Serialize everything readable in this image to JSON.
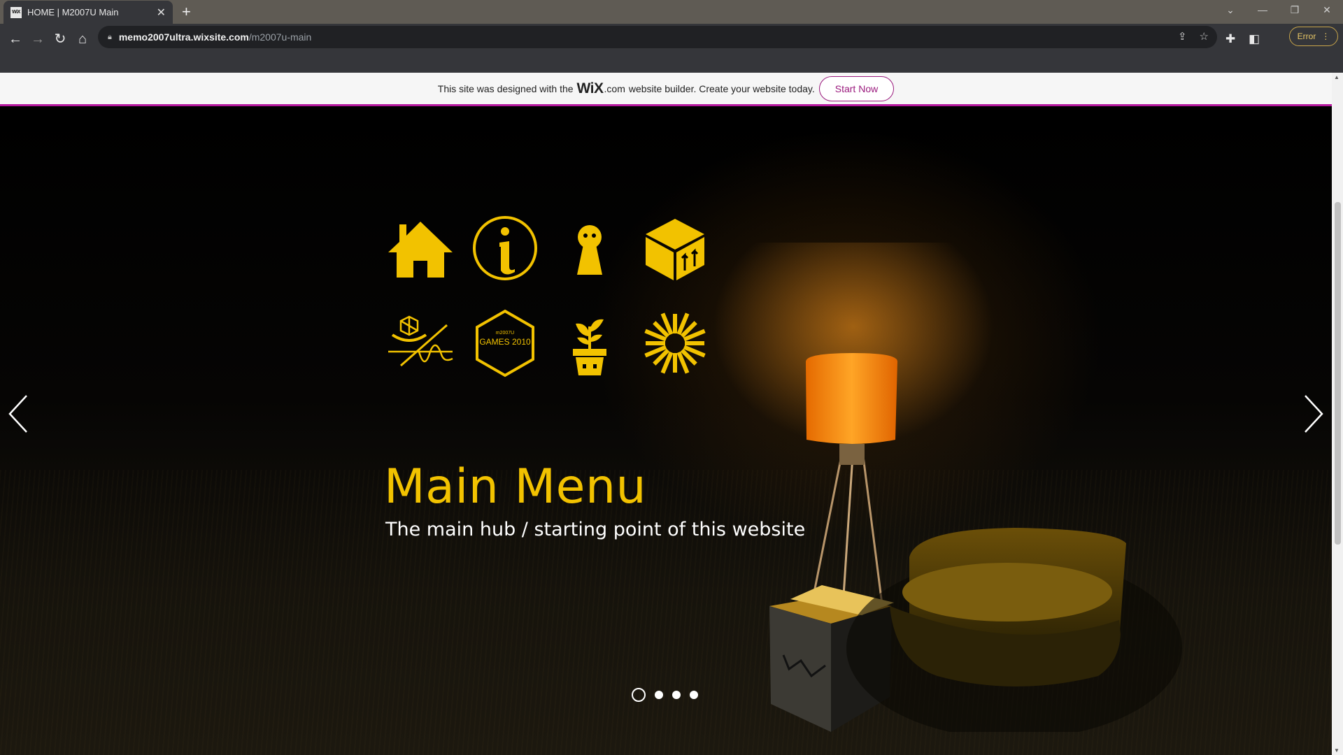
{
  "browser": {
    "tab_title": "HOME | M2007U Main",
    "tab_favicon": "WiX",
    "url_host": "memo2007ultra.wixsite.com",
    "url_path": "/m2007u-main",
    "error_label": "Error"
  },
  "wix_banner": {
    "text_before": "This site was designed with the",
    "logo": "WiX",
    "logo_suffix": ".com",
    "text_after": "website builder. Create your website today.",
    "cta": "Start Now"
  },
  "hero": {
    "title": "Main Menu",
    "subtitle": "The main hub / starting point of this website",
    "games_badge_small": "m2007U",
    "games_badge_label": "GAMES 2010",
    "accent_color": "#f2c200",
    "icons": [
      "home-icon",
      "info-icon",
      "keyhole-icon",
      "package-box-icon",
      "design-tools-icon",
      "games-hexagon-icon",
      "plant-pot-icon",
      "sunburst-icon"
    ],
    "slides": {
      "count": 4,
      "active": 1
    }
  }
}
